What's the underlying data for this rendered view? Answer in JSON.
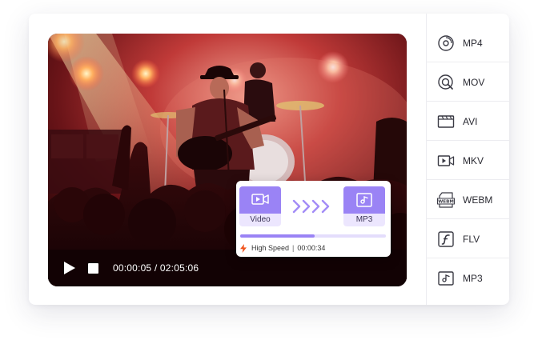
{
  "player": {
    "timecode": "00:00:05 / 02:05:06",
    "controls": {
      "play_icon": "play-icon",
      "stop_icon": "stop-icon"
    }
  },
  "conversion": {
    "source_label": "Video",
    "target_label": "MP3",
    "progress": 0.51,
    "speed_label": "High Speed",
    "separator": "|",
    "elapsed": "00:00:34",
    "accent_color": "#9a83f5",
    "bolt_color": "#f0541e"
  },
  "formats": [
    {
      "name": "MP4",
      "icon": "disc-icon"
    },
    {
      "name": "MOV",
      "icon": "quicktime-icon"
    },
    {
      "name": "AVI",
      "icon": "clapperboard-icon"
    },
    {
      "name": "MKV",
      "icon": "video-camera-icon"
    },
    {
      "name": "WEBM",
      "icon": "webm-icon"
    },
    {
      "name": "FLV",
      "icon": "flash-icon"
    },
    {
      "name": "MP3",
      "icon": "music-image-icon"
    }
  ]
}
